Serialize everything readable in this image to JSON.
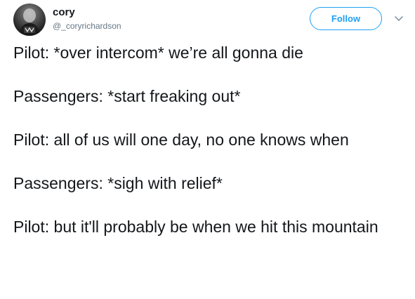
{
  "user": {
    "name": "cory",
    "handle": "@_coryrichardson"
  },
  "actions": {
    "follow_label": "Follow"
  },
  "tweet": {
    "lines": [
      "Pilot: *over intercom* we’re all gonna die",
      "Passengers: *start freaking out*",
      "Pilot: all of us will one day, no one knows when",
      "Passengers: *sigh with relief*",
      "Pilot: but it'll probably be when we hit this mountain"
    ]
  },
  "colors": {
    "accent": "#1da1f2",
    "text": "#14171a",
    "secondary": "#657786"
  },
  "icons": {
    "avatar": "profile-photo",
    "menu": "chevron-down-icon"
  }
}
